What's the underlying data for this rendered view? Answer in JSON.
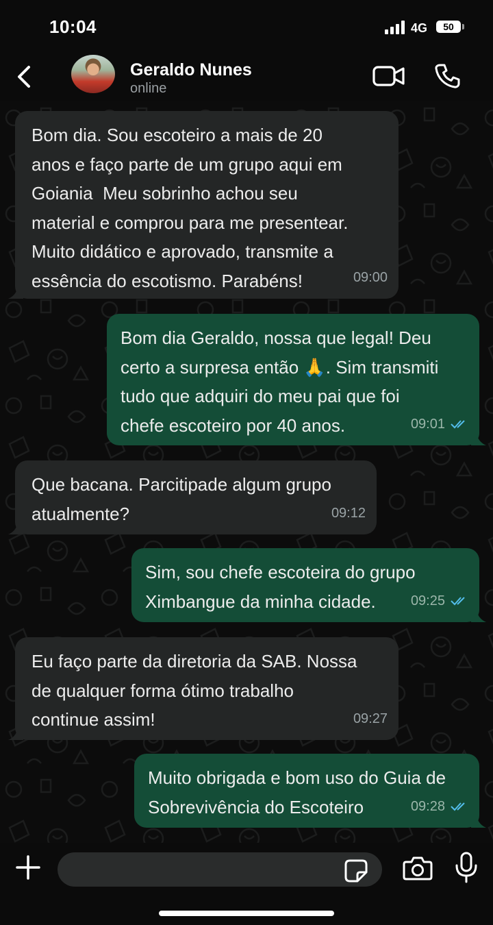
{
  "status_bar": {
    "time": "10:04",
    "network": "4G",
    "battery": "50"
  },
  "header": {
    "back_icon": "chevron-left-icon",
    "contact_name": "Geraldo Nunes",
    "contact_status": "online",
    "video_icon": "video-call-icon",
    "phone_icon": "phone-icon"
  },
  "messages": [
    {
      "direction": "in",
      "text": "Bom dia. Sou escoteiro a mais de 20\nanos e faço parte de um grupo aqui em\nGoiania  Meu sobrinho achou seu\nmaterial e comprou para me presentear.\nMuito didático e aprovado, transmite a\nessência do escotismo. Parabéns!",
      "time": "09:00"
    },
    {
      "direction": "out",
      "text": "Bom dia Geraldo, nossa que legal! Deu\ncerto a surpresa então 🙏. Sim transmiti\ntudo que adquiri do meu pai que foi\nchefe escoteiro por 40 anos.",
      "time": "09:01",
      "read": true
    },
    {
      "direction": "in",
      "text": "Que bacana. Parcitipade algum grupo\natualmente?",
      "time": "09:12"
    },
    {
      "direction": "out",
      "text": "Sim, sou chefe escoteira do grupo\nXimbangue da minha cidade.",
      "time": "09:25",
      "read": true
    },
    {
      "direction": "in",
      "text": "Eu faço parte da diretoria da SAB. Nossa\nde qualquer forma ótimo trabalho\ncontinue assim!",
      "time": "09:27"
    },
    {
      "direction": "out",
      "text": "Muito obrigada e bom uso do Guia de\nSobrevivência do Escoteiro",
      "time": "09:28",
      "read": true
    }
  ],
  "input_bar": {
    "plus_icon": "plus-icon",
    "placeholder": "",
    "sticker_icon": "sticker-icon",
    "camera_icon": "camera-icon",
    "mic_icon": "microphone-icon"
  },
  "colors": {
    "incoming_bubble": "#242626",
    "outgoing_bubble": "#144d37",
    "read_ticks": "#53bdeb",
    "background": "#0b0b0b"
  }
}
